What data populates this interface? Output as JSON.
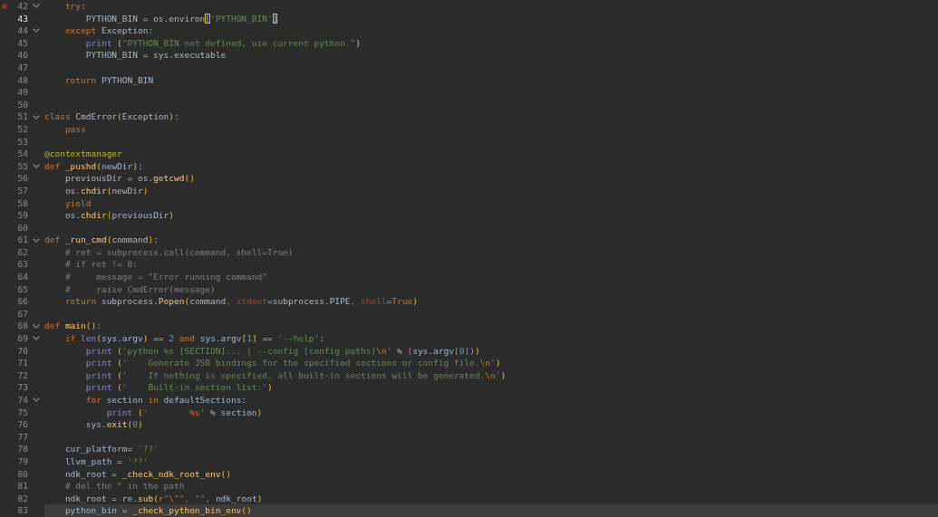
{
  "editor": {
    "lines": [
      {
        "number": "42",
        "fold": true,
        "breakpoint": true,
        "focused": false,
        "current": false,
        "tokens": [
          {
            "text": "    try",
            "kind": "kw"
          },
          {
            "text": ":",
            "kind": "p"
          }
        ]
      },
      {
        "number": "43",
        "fold": false,
        "breakpoint": false,
        "focused": true,
        "current": false,
        "tokens": [
          {
            "text": "        PYTHON_BIN = os.environ",
            "kind": "p"
          },
          {
            "text": "[",
            "kind": "m"
          },
          {
            "text": "'PYTHON_BIN'",
            "kind": "s"
          },
          {
            "text": "]",
            "kind": "m"
          }
        ]
      },
      {
        "number": "44",
        "fold": true,
        "breakpoint": false,
        "focused": false,
        "current": false,
        "tokens": [
          {
            "text": "    except ",
            "kind": "kw"
          },
          {
            "text": "Exception:",
            "kind": "p"
          }
        ]
      },
      {
        "number": "45",
        "fold": false,
        "breakpoint": false,
        "focused": false,
        "current": false,
        "tokens": [
          {
            "text": "        print ",
            "kind": "b"
          },
          {
            "text": "(",
            "kind": "y"
          },
          {
            "text": "\"PYTHON_BIN not defined, use current python.\"",
            "kind": "s"
          },
          {
            "text": ")",
            "kind": "y"
          }
        ]
      },
      {
        "number": "46",
        "fold": false,
        "breakpoint": false,
        "focused": false,
        "current": false,
        "tokens": [
          {
            "text": "        PYTHON_BIN = sys.executable",
            "kind": "p"
          }
        ]
      },
      {
        "number": "47",
        "fold": false,
        "breakpoint": false,
        "focused": false,
        "current": false
      },
      {
        "number": "48",
        "fold": false,
        "breakpoint": false,
        "focused": false,
        "current": false,
        "tokens": [
          {
            "text": "    return ",
            "kind": "kw"
          },
          {
            "text": "PYTHON_BIN",
            "kind": "p"
          }
        ]
      },
      {
        "number": "49",
        "fold": false,
        "breakpoint": false,
        "focused": false,
        "current": false
      },
      {
        "number": "50",
        "fold": false,
        "breakpoint": false,
        "focused": false,
        "current": false
      },
      {
        "number": "51",
        "fold": true,
        "breakpoint": false,
        "focused": false,
        "current": false,
        "tokens": [
          {
            "text": "class ",
            "kind": "kw"
          },
          {
            "text": "CmdError",
            "kind": "p"
          },
          {
            "text": "(",
            "kind": "y"
          },
          {
            "text": "Exception",
            "kind": "p"
          },
          {
            "text": ")",
            "kind": "y"
          },
          {
            "text": ":",
            "kind": "p"
          }
        ]
      },
      {
        "number": "52",
        "fold": false,
        "breakpoint": false,
        "focused": false,
        "current": false,
        "tokens": [
          {
            "text": "    pass",
            "kind": "kw"
          }
        ]
      },
      {
        "number": "53",
        "fold": false,
        "breakpoint": false,
        "focused": false,
        "current": false
      },
      {
        "number": "54",
        "fold": false,
        "breakpoint": false,
        "focused": false,
        "current": false,
        "tokens": [
          {
            "text": "@contextmanager",
            "kind": "d"
          }
        ]
      },
      {
        "number": "55",
        "fold": true,
        "breakpoint": false,
        "focused": false,
        "current": false,
        "tokens": [
          {
            "text": "def ",
            "kind": "kw"
          },
          {
            "text": "_pushd",
            "kind": "f"
          },
          {
            "text": "(",
            "kind": "y"
          },
          {
            "text": "newDir",
            "kind": "p"
          },
          {
            "text": ")",
            "kind": "y"
          },
          {
            "text": ":",
            "kind": "p"
          }
        ]
      },
      {
        "number": "56",
        "fold": false,
        "breakpoint": false,
        "focused": false,
        "current": false,
        "tokens": [
          {
            "text": "    previousDir = os.",
            "kind": "p"
          },
          {
            "text": "getcwd",
            "kind": "f"
          },
          {
            "text": "()",
            "kind": "y"
          }
        ]
      },
      {
        "number": "57",
        "fold": false,
        "breakpoint": false,
        "focused": false,
        "current": false,
        "tokens": [
          {
            "text": "    os.",
            "kind": "p"
          },
          {
            "text": "chdir",
            "kind": "f"
          },
          {
            "text": "(",
            "kind": "y"
          },
          {
            "text": "newDir",
            "kind": "p"
          },
          {
            "text": ")",
            "kind": "y"
          }
        ]
      },
      {
        "number": "58",
        "fold": false,
        "breakpoint": false,
        "focused": false,
        "current": false,
        "tokens": [
          {
            "text": "    yield",
            "kind": "kw"
          }
        ]
      },
      {
        "number": "59",
        "fold": false,
        "breakpoint": false,
        "focused": false,
        "current": false,
        "tokens": [
          {
            "text": "    os.",
            "kind": "p"
          },
          {
            "text": "chdir",
            "kind": "f"
          },
          {
            "text": "(",
            "kind": "y"
          },
          {
            "text": "previousDir",
            "kind": "p"
          },
          {
            "text": ")",
            "kind": "y"
          }
        ]
      },
      {
        "number": "60",
        "fold": false,
        "breakpoint": false,
        "focused": false,
        "current": false
      },
      {
        "number": "61",
        "fold": true,
        "breakpoint": false,
        "focused": false,
        "current": false,
        "tokens": [
          {
            "text": "def ",
            "kind": "kw"
          },
          {
            "text": "_run_cmd",
            "kind": "f"
          },
          {
            "text": "(",
            "kind": "y"
          },
          {
            "text": "command",
            "kind": "p"
          },
          {
            "text": ")",
            "kind": "y"
          },
          {
            "text": ":",
            "kind": "p"
          }
        ]
      },
      {
        "number": "62",
        "fold": false,
        "breakpoint": false,
        "focused": false,
        "current": false,
        "tokens": [
          {
            "text": "    # ret = subprocess.call(command, shell=True)",
            "kind": "c"
          }
        ]
      },
      {
        "number": "63",
        "fold": false,
        "breakpoint": false,
        "focused": false,
        "current": false,
        "tokens": [
          {
            "text": "    # if ret != 0:",
            "kind": "c"
          }
        ]
      },
      {
        "number": "64",
        "fold": false,
        "breakpoint": false,
        "focused": false,
        "current": false,
        "tokens": [
          {
            "text": "    #     message = \"Error running command\"",
            "kind": "c"
          }
        ]
      },
      {
        "number": "65",
        "fold": false,
        "breakpoint": false,
        "focused": false,
        "current": false,
        "tokens": [
          {
            "text": "    #     raise CmdError(message)",
            "kind": "c"
          }
        ]
      },
      {
        "number": "66",
        "fold": false,
        "breakpoint": false,
        "focused": false,
        "current": false,
        "tokens": [
          {
            "text": "    return ",
            "kind": "kw"
          },
          {
            "text": "subprocess.",
            "kind": "p"
          },
          {
            "text": "Popen",
            "kind": "f"
          },
          {
            "text": "(",
            "kind": "y"
          },
          {
            "text": "command",
            "kind": "p"
          },
          {
            "text": ", ",
            "kind": "kw"
          },
          {
            "text": "stdout",
            "kind": "k"
          },
          {
            "text": "=subprocess.PIPE",
            "kind": "p"
          },
          {
            "text": ", ",
            "kind": "kw"
          },
          {
            "text": "shell",
            "kind": "k"
          },
          {
            "text": "=",
            "kind": "p"
          },
          {
            "text": "True",
            "kind": "kw"
          },
          {
            "text": ")",
            "kind": "y"
          }
        ]
      },
      {
        "number": "67",
        "fold": false,
        "breakpoint": false,
        "focused": false,
        "current": false
      },
      {
        "number": "68",
        "fold": true,
        "breakpoint": false,
        "focused": false,
        "current": false,
        "tokens": [
          {
            "text": "def ",
            "kind": "kw"
          },
          {
            "text": "main",
            "kind": "f"
          },
          {
            "text": "()",
            "kind": "y"
          },
          {
            "text": ":",
            "kind": "p"
          }
        ]
      },
      {
        "number": "69",
        "fold": true,
        "breakpoint": false,
        "focused": false,
        "current": false,
        "tokens": [
          {
            "text": "    if ",
            "kind": "kw"
          },
          {
            "text": "len",
            "kind": "b"
          },
          {
            "text": "(",
            "kind": "y"
          },
          {
            "text": "sys.argv",
            "kind": "p"
          },
          {
            "text": ")",
            "kind": "y"
          },
          {
            "text": " == ",
            "kind": "p"
          },
          {
            "text": "2",
            "kind": "n"
          },
          {
            "text": " and ",
            "kind": "kw"
          },
          {
            "text": "sys.argv",
            "kind": "p"
          },
          {
            "text": "[",
            "kind": "y"
          },
          {
            "text": "1",
            "kind": "n"
          },
          {
            "text": "]",
            "kind": "y"
          },
          {
            "text": " == ",
            "kind": "p"
          },
          {
            "text": "'--help'",
            "kind": "s"
          },
          {
            "text": ":",
            "kind": "p"
          }
        ]
      },
      {
        "number": "70",
        "fold": false,
        "breakpoint": false,
        "focused": false,
        "current": false,
        "tokens": [
          {
            "text": "        print ",
            "kind": "b"
          },
          {
            "text": "(",
            "kind": "y"
          },
          {
            "text": "'python %s [SECTION]... | --config [config paths]",
            "kind": "s"
          },
          {
            "text": "\\n",
            "kind": "e"
          },
          {
            "text": "'",
            "kind": "s"
          },
          {
            "text": " % ",
            "kind": "p"
          },
          {
            "text": "(",
            "kind": "v"
          },
          {
            "text": "sys.argv",
            "kind": "p"
          },
          {
            "text": "[",
            "kind": "l"
          },
          {
            "text": "0",
            "kind": "n"
          },
          {
            "text": "]",
            "kind": "l"
          },
          {
            "text": ")",
            "kind": "v"
          },
          {
            "text": ")",
            "kind": "y"
          }
        ]
      },
      {
        "number": "71",
        "fold": false,
        "breakpoint": false,
        "focused": false,
        "current": false,
        "tokens": [
          {
            "text": "        print ",
            "kind": "b"
          },
          {
            "text": "(",
            "kind": "y"
          },
          {
            "text": "'    Generate JSB bindings for the specified sections or config file.",
            "kind": "s"
          },
          {
            "text": "\\n",
            "kind": "e"
          },
          {
            "text": "'",
            "kind": "s"
          },
          {
            "text": ")",
            "kind": "y"
          }
        ]
      },
      {
        "number": "72",
        "fold": false,
        "breakpoint": false,
        "focused": false,
        "current": false,
        "tokens": [
          {
            "text": "        print ",
            "kind": "b"
          },
          {
            "text": "(",
            "kind": "y"
          },
          {
            "text": "'    If nothing is specified, all built-in sections will be generated.",
            "kind": "s"
          },
          {
            "text": "\\n",
            "kind": "e"
          },
          {
            "text": "'",
            "kind": "s"
          },
          {
            "text": ")",
            "kind": "y"
          }
        ]
      },
      {
        "number": "73",
        "fold": false,
        "breakpoint": false,
        "focused": false,
        "current": false,
        "tokens": [
          {
            "text": "        print ",
            "kind": "b"
          },
          {
            "text": "(",
            "kind": "y"
          },
          {
            "text": "'    Built-in section list:'",
            "kind": "s"
          },
          {
            "text": ")",
            "kind": "y"
          }
        ]
      },
      {
        "number": "74",
        "fold": true,
        "breakpoint": false,
        "focused": false,
        "current": false,
        "tokens": [
          {
            "text": "        for ",
            "kind": "kw"
          },
          {
            "text": "section ",
            "kind": "p"
          },
          {
            "text": "in ",
            "kind": "kw"
          },
          {
            "text": "defaultSections:",
            "kind": "p"
          }
        ]
      },
      {
        "number": "75",
        "fold": false,
        "breakpoint": false,
        "focused": false,
        "current": false,
        "tokens": [
          {
            "text": "            print ",
            "kind": "b"
          },
          {
            "text": "(",
            "kind": "y"
          },
          {
            "text": "'        ",
            "kind": "s"
          },
          {
            "text": "%s",
            "kind": "e"
          },
          {
            "text": "'",
            "kind": "s"
          },
          {
            "text": " % section",
            "kind": "p"
          },
          {
            "text": ")",
            "kind": "y"
          }
        ]
      },
      {
        "number": "76",
        "fold": false,
        "breakpoint": false,
        "focused": false,
        "current": false,
        "tokens": [
          {
            "text": "        sys.",
            "kind": "p"
          },
          {
            "text": "exit",
            "kind": "f"
          },
          {
            "text": "(",
            "kind": "y"
          },
          {
            "text": "0",
            "kind": "n"
          },
          {
            "text": ")",
            "kind": "y"
          }
        ]
      },
      {
        "number": "77",
        "fold": false,
        "breakpoint": false,
        "focused": false,
        "current": false
      },
      {
        "number": "78",
        "fold": false,
        "breakpoint": false,
        "focused": false,
        "current": false,
        "tokens": [
          {
            "text": "    cur_platform= ",
            "kind": "p"
          },
          {
            "text": "'??'",
            "kind": "s"
          }
        ]
      },
      {
        "number": "79",
        "fold": false,
        "breakpoint": false,
        "focused": false,
        "current": false,
        "tokens": [
          {
            "text": "    llvm_path = ",
            "kind": "p"
          },
          {
            "text": "'??'",
            "kind": "s"
          }
        ]
      },
      {
        "number": "80",
        "fold": false,
        "breakpoint": false,
        "focused": false,
        "current": false,
        "tokens": [
          {
            "text": "    ndk_root = ",
            "kind": "p"
          },
          {
            "text": "_check_ndk_root_env",
            "kind": "f"
          },
          {
            "text": "()",
            "kind": "y"
          }
        ]
      },
      {
        "number": "81",
        "fold": false,
        "breakpoint": false,
        "focused": false,
        "current": false,
        "tokens": [
          {
            "text": "    # del the \" in the path",
            "kind": "c"
          }
        ]
      },
      {
        "number": "82",
        "fold": false,
        "breakpoint": false,
        "focused": false,
        "current": false,
        "tokens": [
          {
            "text": "    ndk_root = re.",
            "kind": "p"
          },
          {
            "text": "sub",
            "kind": "f"
          },
          {
            "text": "(",
            "kind": "y"
          },
          {
            "text": "r",
            "kind": "kw"
          },
          {
            "text": "\"",
            "kind": "s"
          },
          {
            "text": "\\\"",
            "kind": "e"
          },
          {
            "text": "\"",
            "kind": "s"
          },
          {
            "text": ", ",
            "kind": "kw"
          },
          {
            "text": "\"\"",
            "kind": "s"
          },
          {
            "text": ", ",
            "kind": "kw"
          },
          {
            "text": "ndk_root",
            "kind": "p"
          },
          {
            "text": ")",
            "kind": "y"
          }
        ]
      },
      {
        "number": "83",
        "fold": false,
        "breakpoint": false,
        "focused": false,
        "current": true,
        "tokens": [
          {
            "text": "    python_bin = ",
            "kind": "p"
          },
          {
            "text": "_check_python_bin_env",
            "kind": "f"
          },
          {
            "text": "()",
            "kind": "y"
          }
        ]
      }
    ]
  }
}
